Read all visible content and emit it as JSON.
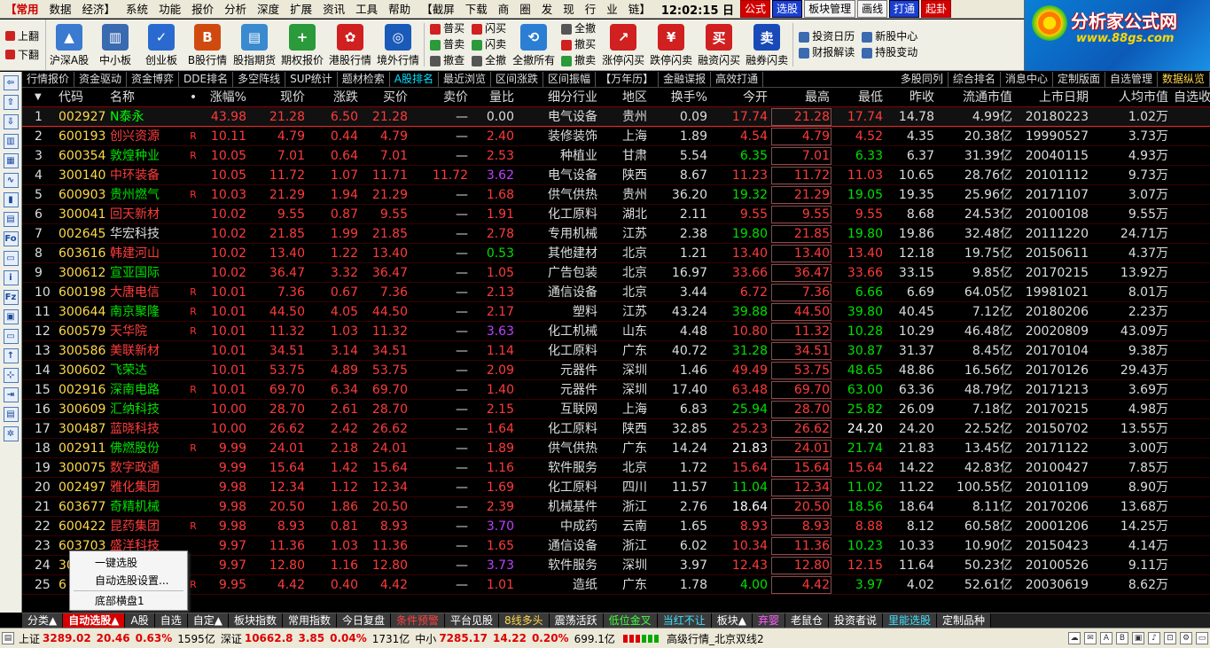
{
  "menu": {
    "items": [
      "【常用",
      "数据",
      "经济】",
      "系统",
      "功能",
      "报价",
      "分析",
      "深度",
      "扩展",
      "资讯",
      "工具",
      "帮助",
      "【截屏",
      "下载",
      "商",
      "圈",
      "发",
      "现",
      "行",
      "业",
      "链】"
    ],
    "clock": "12:02:15 日",
    "tags": [
      "公式",
      "选股",
      "板块管理",
      "画线",
      "打通",
      "起卦"
    ]
  },
  "logo": {
    "title": "分析家公式网",
    "url": "www.88gs.com"
  },
  "toolbar": {
    "side": [
      "上翻",
      "下翻"
    ],
    "buttons": [
      "沪深A股",
      "中小板",
      "创业板",
      "B股行情",
      "股指期货",
      "期权报价",
      "港股行情",
      "境外行情"
    ],
    "grid1": [
      "普买",
      "普卖",
      "撤查"
    ],
    "grid2": [
      "闪买",
      "闪卖",
      "全撤"
    ],
    "btn_all": "全撤所有",
    "grid3": [
      "全撤",
      "撤买",
      "撤卖"
    ],
    "flash": [
      "涨停闪买",
      "跌停闪卖",
      "融资闪买",
      "融券闪卖"
    ],
    "right": [
      "投资日历",
      "新股中心",
      "财报解读",
      "持股变动"
    ]
  },
  "subtabs": [
    "行情报价",
    "资金驱动",
    "资金博弈",
    "DDE排名",
    "多空阵线",
    "SUP统计",
    "题材检索",
    "A股排名",
    "最近浏览",
    "区间涨跌",
    "区间振幅",
    "【万年历】",
    "金融谍报",
    "高效打通"
  ],
  "subtabs_right": [
    "多股同列",
    "综合排名",
    "消息中心",
    "定制版面",
    "自选管理",
    "数据纵览"
  ],
  "headers": {
    "idx": "",
    "code": "代码",
    "name": "名称",
    "chg": "涨幅%",
    "price": "现价",
    "diff": "涨跌",
    "bid": "买价",
    "ask": "卖价",
    "ratio": "量比",
    "ind": "细分行业",
    "area": "地区",
    "turn": "换手%",
    "open": "今开",
    "high": "最高",
    "low": "最低",
    "prev": "昨收",
    "cap": "流通市值",
    "date": "上市日期",
    "asset": "人均市值",
    "self": "自选收益%"
  },
  "rows": [
    {
      "i": "1",
      "code": "002927",
      "name": "N泰永",
      "nc": "hl",
      "flag": "",
      "chg": "43.98",
      "price": "21.28",
      "diff": "6.50",
      "bid": "21.28",
      "ask": "—",
      "ratio": "0.00",
      "rc": "eq",
      "ind": "电气设备",
      "area": "贵州",
      "turn": "0.09",
      "open": "17.74",
      "oc": "up",
      "high": "21.28",
      "low": "17.74",
      "lc": "up",
      "prev": "14.78",
      "cap": "4.99亿",
      "date": "20180223",
      "asset": "1.02万",
      "self": "—"
    },
    {
      "i": "2",
      "code": "600193",
      "name": "创兴资源",
      "nc": "up",
      "flag": "R",
      "chg": "10.11",
      "price": "4.79",
      "diff": "0.44",
      "bid": "4.79",
      "ask": "—",
      "ratio": "2.40",
      "rc": "up",
      "ind": "装修装饰",
      "area": "上海",
      "turn": "1.89",
      "open": "4.54",
      "oc": "up",
      "high": "4.79",
      "low": "4.52",
      "lc": "up",
      "prev": "4.35",
      "cap": "20.38亿",
      "date": "19990527",
      "asset": "3.73万",
      "self": "—"
    },
    {
      "i": "3",
      "code": "600354",
      "name": "敦煌种业",
      "nc": "dn",
      "flag": "R",
      "chg": "10.05",
      "price": "7.01",
      "diff": "0.64",
      "bid": "7.01",
      "ask": "—",
      "ratio": "2.53",
      "rc": "up",
      "ind": "种植业",
      "area": "甘肃",
      "turn": "5.54",
      "open": "6.35",
      "oc": "dn",
      "high": "7.01",
      "low": "6.33",
      "lc": "dn",
      "prev": "6.37",
      "cap": "31.39亿",
      "date": "20040115",
      "asset": "4.93万",
      "self": "—"
    },
    {
      "i": "4",
      "code": "300140",
      "name": "中环装备",
      "nc": "up",
      "flag": "",
      "chg": "10.05",
      "price": "11.72",
      "diff": "1.07",
      "bid": "11.71",
      "ask": "11.72",
      "ratio": "3.62",
      "rc": "pur",
      "ind": "电气设备",
      "area": "陕西",
      "turn": "8.67",
      "open": "11.23",
      "oc": "up",
      "high": "11.72",
      "low": "11.03",
      "lc": "up",
      "prev": "10.65",
      "cap": "28.76亿",
      "date": "20101112",
      "asset": "9.73万",
      "self": "—"
    },
    {
      "i": "5",
      "code": "600903",
      "name": "贵州燃气",
      "nc": "dn",
      "flag": "R",
      "chg": "10.03",
      "price": "21.29",
      "diff": "1.94",
      "bid": "21.29",
      "ask": "—",
      "ratio": "1.68",
      "rc": "up",
      "ind": "供气供热",
      "area": "贵州",
      "turn": "36.20",
      "open": "19.32",
      "oc": "dn",
      "high": "21.29",
      "low": "19.05",
      "lc": "dn",
      "prev": "19.35",
      "cap": "25.96亿",
      "date": "20171107",
      "asset": "3.07万",
      "self": "—"
    },
    {
      "i": "6",
      "code": "300041",
      "name": "回天新材",
      "nc": "up",
      "flag": "",
      "chg": "10.02",
      "price": "9.55",
      "diff": "0.87",
      "bid": "9.55",
      "ask": "—",
      "ratio": "1.91",
      "rc": "up",
      "ind": "化工原料",
      "area": "湖北",
      "turn": "2.11",
      "open": "9.55",
      "oc": "up",
      "high": "9.55",
      "low": "9.55",
      "lc": "up",
      "prev": "8.68",
      "cap": "24.53亿",
      "date": "20100108",
      "asset": "9.55万",
      "self": "—"
    },
    {
      "i": "7",
      "code": "002645",
      "name": "华宏科技",
      "nc": "eq",
      "flag": "",
      "chg": "10.02",
      "price": "21.85",
      "diff": "1.99",
      "bid": "21.85",
      "ask": "—",
      "ratio": "2.78",
      "rc": "up",
      "ind": "专用机械",
      "area": "江苏",
      "turn": "2.38",
      "open": "19.80",
      "oc": "dn",
      "high": "21.85",
      "low": "19.80",
      "lc": "dn",
      "prev": "19.86",
      "cap": "32.48亿",
      "date": "20111220",
      "asset": "24.71万",
      "self": "—"
    },
    {
      "i": "8",
      "code": "603616",
      "name": "韩建河山",
      "nc": "up",
      "flag": "",
      "chg": "10.02",
      "price": "13.40",
      "diff": "1.22",
      "bid": "13.40",
      "ask": "—",
      "ratio": "0.53",
      "rc": "dn",
      "ind": "其他建材",
      "area": "北京",
      "turn": "1.21",
      "open": "13.40",
      "oc": "up",
      "high": "13.40",
      "low": "13.40",
      "lc": "up",
      "prev": "12.18",
      "cap": "19.75亿",
      "date": "20150611",
      "asset": "4.37万",
      "self": "—"
    },
    {
      "i": "9",
      "code": "300612",
      "name": "宣亚国际",
      "nc": "dn",
      "flag": "",
      "chg": "10.02",
      "price": "36.47",
      "diff": "3.32",
      "bid": "36.47",
      "ask": "—",
      "ratio": "1.05",
      "rc": "up",
      "ind": "广告包装",
      "area": "北京",
      "turn": "16.97",
      "open": "33.66",
      "oc": "up",
      "high": "36.47",
      "low": "33.66",
      "lc": "up",
      "prev": "33.15",
      "cap": "9.85亿",
      "date": "20170215",
      "asset": "13.92万",
      "self": "—"
    },
    {
      "i": "10",
      "code": "600198",
      "name": "大唐电信",
      "nc": "up",
      "flag": "R",
      "chg": "10.01",
      "price": "7.36",
      "diff": "0.67",
      "bid": "7.36",
      "ask": "—",
      "ratio": "2.13",
      "rc": "up",
      "ind": "通信设备",
      "area": "北京",
      "turn": "3.44",
      "open": "6.72",
      "oc": "up",
      "high": "7.36",
      "low": "6.66",
      "lc": "dn",
      "prev": "6.69",
      "cap": "64.05亿",
      "date": "19981021",
      "asset": "8.01万",
      "self": "—"
    },
    {
      "i": "11",
      "code": "300644",
      "name": "南京聚隆",
      "nc": "dn",
      "flag": "R",
      "chg": "10.01",
      "price": "44.50",
      "diff": "4.05",
      "bid": "44.50",
      "ask": "—",
      "ratio": "2.17",
      "rc": "up",
      "ind": "塑料",
      "area": "江苏",
      "turn": "43.24",
      "open": "39.88",
      "oc": "dn",
      "high": "44.50",
      "low": "39.80",
      "lc": "dn",
      "prev": "40.45",
      "cap": "7.12亿",
      "date": "20180206",
      "asset": "2.23万",
      "self": "—"
    },
    {
      "i": "12",
      "code": "600579",
      "name": "天华院",
      "nc": "up",
      "flag": "R",
      "chg": "10.01",
      "price": "11.32",
      "diff": "1.03",
      "bid": "11.32",
      "ask": "—",
      "ratio": "3.63",
      "rc": "pur",
      "ind": "化工机械",
      "area": "山东",
      "turn": "4.48",
      "open": "10.80",
      "oc": "up",
      "high": "11.32",
      "low": "10.28",
      "lc": "dn",
      "prev": "10.29",
      "cap": "46.48亿",
      "date": "20020809",
      "asset": "43.09万",
      "self": "—"
    },
    {
      "i": "13",
      "code": "300586",
      "name": "美联新材",
      "nc": "up",
      "flag": "",
      "chg": "10.01",
      "price": "34.51",
      "diff": "3.14",
      "bid": "34.51",
      "ask": "—",
      "ratio": "1.14",
      "rc": "up",
      "ind": "化工原料",
      "area": "广东",
      "turn": "40.72",
      "open": "31.28",
      "oc": "dn",
      "high": "34.51",
      "low": "30.87",
      "lc": "dn",
      "prev": "31.37",
      "cap": "8.45亿",
      "date": "20170104",
      "asset": "9.38万",
      "self": "—"
    },
    {
      "i": "14",
      "code": "300602",
      "name": "飞荣达",
      "nc": "dn",
      "flag": "",
      "chg": "10.01",
      "price": "53.75",
      "diff": "4.89",
      "bid": "53.75",
      "ask": "—",
      "ratio": "2.09",
      "rc": "up",
      "ind": "元器件",
      "area": "深圳",
      "turn": "1.46",
      "open": "49.49",
      "oc": "up",
      "high": "53.75",
      "low": "48.65",
      "lc": "dn",
      "prev": "48.86",
      "cap": "16.56亿",
      "date": "20170126",
      "asset": "29.43万",
      "self": "—"
    },
    {
      "i": "15",
      "code": "002916",
      "name": "深南电路",
      "nc": "dn",
      "flag": "R",
      "chg": "10.01",
      "price": "69.70",
      "diff": "6.34",
      "bid": "69.70",
      "ask": "—",
      "ratio": "1.40",
      "rc": "up",
      "ind": "元器件",
      "area": "深圳",
      "turn": "17.40",
      "open": "63.48",
      "oc": "up",
      "high": "69.70",
      "low": "63.00",
      "lc": "dn",
      "prev": "63.36",
      "cap": "48.79亿",
      "date": "20171213",
      "asset": "3.69万",
      "self": "—"
    },
    {
      "i": "16",
      "code": "300609",
      "name": "汇纳科技",
      "nc": "dn",
      "flag": "",
      "chg": "10.00",
      "price": "28.70",
      "diff": "2.61",
      "bid": "28.70",
      "ask": "—",
      "ratio": "2.15",
      "rc": "up",
      "ind": "互联网",
      "area": "上海",
      "turn": "6.83",
      "open": "25.94",
      "oc": "dn",
      "high": "28.70",
      "low": "25.82",
      "lc": "dn",
      "prev": "26.09",
      "cap": "7.18亿",
      "date": "20170215",
      "asset": "4.98万",
      "self": "—"
    },
    {
      "i": "17",
      "code": "300487",
      "name": "蓝晓科技",
      "nc": "up",
      "flag": "",
      "chg": "10.00",
      "price": "26.62",
      "diff": "2.42",
      "bid": "26.62",
      "ask": "—",
      "ratio": "1.64",
      "rc": "up",
      "ind": "化工原料",
      "area": "陕西",
      "turn": "32.85",
      "open": "25.23",
      "oc": "up",
      "high": "26.62",
      "low": "24.20",
      "lc": "wh",
      "prev": "24.20",
      "cap": "22.52亿",
      "date": "20150702",
      "asset": "13.55万",
      "self": "—"
    },
    {
      "i": "18",
      "code": "002911",
      "name": "佛燃股份",
      "nc": "dn",
      "flag": "R",
      "chg": "9.99",
      "price": "24.01",
      "diff": "2.18",
      "bid": "24.01",
      "ask": "—",
      "ratio": "1.89",
      "rc": "up",
      "ind": "供气供热",
      "area": "广东",
      "turn": "14.24",
      "open": "21.83",
      "oc": "wh",
      "high": "24.01",
      "low": "21.74",
      "lc": "dn",
      "prev": "21.83",
      "cap": "13.45亿",
      "date": "20171122",
      "asset": "3.00万",
      "self": "—"
    },
    {
      "i": "19",
      "code": "300075",
      "name": "数字政通",
      "nc": "up",
      "flag": "",
      "chg": "9.99",
      "price": "15.64",
      "diff": "1.42",
      "bid": "15.64",
      "ask": "—",
      "ratio": "1.16",
      "rc": "up",
      "ind": "软件服务",
      "area": "北京",
      "turn": "1.72",
      "open": "15.64",
      "oc": "up",
      "high": "15.64",
      "low": "15.64",
      "lc": "up",
      "prev": "14.22",
      "cap": "42.83亿",
      "date": "20100427",
      "asset": "7.85万",
      "self": "—"
    },
    {
      "i": "20",
      "code": "002497",
      "name": "雅化集团",
      "nc": "up",
      "flag": "",
      "chg": "9.98",
      "price": "12.34",
      "diff": "1.12",
      "bid": "12.34",
      "ask": "—",
      "ratio": "1.69",
      "rc": "up",
      "ind": "化工原料",
      "area": "四川",
      "turn": "11.57",
      "open": "11.04",
      "oc": "dn",
      "high": "12.34",
      "low": "11.02",
      "lc": "dn",
      "prev": "11.22",
      "cap": "100.55亿",
      "date": "20101109",
      "asset": "8.90万",
      "self": "—"
    },
    {
      "i": "21",
      "code": "603677",
      "name": "奇精机械",
      "nc": "dn",
      "flag": "",
      "chg": "9.98",
      "price": "20.50",
      "diff": "1.86",
      "bid": "20.50",
      "ask": "—",
      "ratio": "2.39",
      "rc": "up",
      "ind": "机械基件",
      "area": "浙江",
      "turn": "2.76",
      "open": "18.64",
      "oc": "wh",
      "high": "20.50",
      "low": "18.56",
      "lc": "dn",
      "prev": "18.64",
      "cap": "8.11亿",
      "date": "20170206",
      "asset": "13.68万",
      "self": "—"
    },
    {
      "i": "22",
      "code": "600422",
      "name": "昆药集团",
      "nc": "up",
      "flag": "R",
      "chg": "9.98",
      "price": "8.93",
      "diff": "0.81",
      "bid": "8.93",
      "ask": "—",
      "ratio": "3.70",
      "rc": "pur",
      "ind": "中成药",
      "area": "云南",
      "turn": "1.65",
      "open": "8.93",
      "oc": "up",
      "high": "8.93",
      "low": "8.88",
      "lc": "up",
      "prev": "8.12",
      "cap": "60.58亿",
      "date": "20001206",
      "asset": "14.25万",
      "self": "—"
    },
    {
      "i": "23",
      "code": "603703",
      "name": "盛洋科技",
      "nc": "up",
      "flag": "",
      "chg": "9.97",
      "price": "11.36",
      "diff": "1.03",
      "bid": "11.36",
      "ask": "—",
      "ratio": "1.65",
      "rc": "up",
      "ind": "通信设备",
      "area": "浙江",
      "turn": "6.02",
      "open": "10.34",
      "oc": "up",
      "high": "11.36",
      "low": "10.23",
      "lc": "dn",
      "prev": "10.33",
      "cap": "10.90亿",
      "date": "20150423",
      "asset": "4.14万",
      "self": "—"
    },
    {
      "i": "24",
      "code": "300",
      "name": "",
      "nc": "up",
      "flag": "",
      "chg": "9.97",
      "price": "12.80",
      "diff": "1.16",
      "bid": "12.80",
      "ask": "—",
      "ratio": "3.73",
      "rc": "pur",
      "ind": "软件服务",
      "area": "深圳",
      "turn": "3.97",
      "open": "12.43",
      "oc": "up",
      "high": "12.80",
      "low": "12.15",
      "lc": "up",
      "prev": "11.64",
      "cap": "50.23亿",
      "date": "20100526",
      "asset": "9.11万",
      "self": "—"
    },
    {
      "i": "25",
      "code": "6",
      "name": "",
      "nc": "up",
      "flag": "R",
      "chg": "9.95",
      "price": "4.42",
      "diff": "0.40",
      "bid": "4.42",
      "ask": "—",
      "ratio": "1.01",
      "rc": "up",
      "ind": "造纸",
      "area": "广东",
      "turn": "1.78",
      "open": "4.00",
      "oc": "dn",
      "high": "4.42",
      "low": "3.97",
      "lc": "dn",
      "prev": "4.02",
      "cap": "52.61亿",
      "date": "20030619",
      "asset": "8.62万",
      "self": "—"
    }
  ],
  "popup": [
    "一键选股",
    "自动选股设置...",
    "底部横盘1"
  ],
  "bottomtabs": [
    "分类▲",
    "自动选股▲",
    "A股",
    "自选",
    "自定▲",
    "板块指数",
    "常用指数",
    "今日复盘",
    "条件预警",
    "平台见股",
    "8线多头",
    "震荡活跃",
    "低位金叉",
    "当红不让",
    "板块▲",
    "弃婴",
    "老鼠仓",
    "投资者说",
    "里能选股",
    "定制品种"
  ],
  "status": {
    "sh_label": "上证",
    "sh_val": "3289.02",
    "sh_chg": "20.46",
    "sh_pct": "0.63%",
    "sh_amt": "1595亿",
    "sz_label": "深证",
    "sz_val": "10662.8",
    "sz_chg": "3.85",
    "sz_pct": "0.04%",
    "sz_amt": "1731亿",
    "zx_label": "中小",
    "zx_val": "7285.17",
    "zx_chg": "14.22",
    "zx_pct": "0.20%",
    "zx_amt": "699.1亿",
    "server": "高级行情_北京双线2"
  }
}
